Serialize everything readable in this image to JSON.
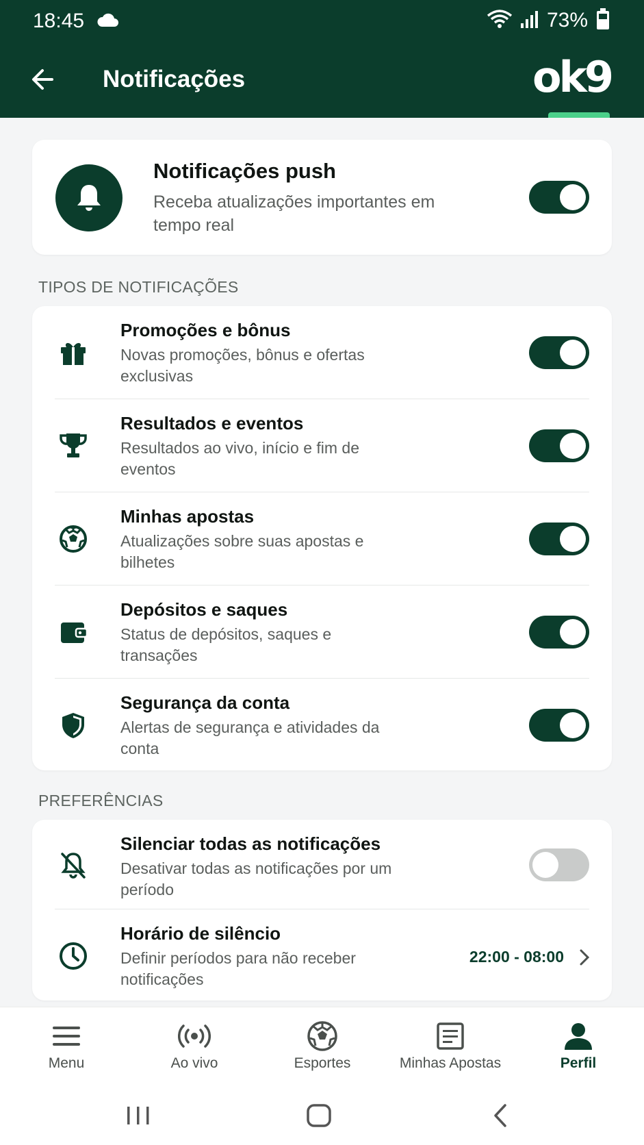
{
  "status_bar": {
    "time": "18:45",
    "battery": "73%",
    "icons": [
      "cloud-icon",
      "wifi-icon",
      "signal-icon",
      "battery-icon"
    ]
  },
  "app_bar": {
    "title": "Notificações",
    "logo": "ok9",
    "back_icon": "arrow-left-icon"
  },
  "push": {
    "title": "Notificações push",
    "description": "Receba atualizações importantes em tempo real",
    "enabled": true
  },
  "types_section": {
    "label": "TIPOS DE NOTIFICAÇÕES",
    "items": [
      {
        "title": "Promoções e bônus",
        "description": "Novas promoções, bônus e ofertas exclusivas",
        "icon": "gift-icon",
        "enabled": true
      },
      {
        "title": "Resultados e eventos",
        "description": "Resultados ao vivo, início e fim de eventos",
        "icon": "trophy-icon",
        "enabled": true
      },
      {
        "title": "Minhas apostas",
        "description": "Atualizações sobre suas apostas e bilhetes",
        "icon": "soccer-ball-icon",
        "enabled": true
      },
      {
        "title": "Depósitos e saques",
        "description": "Status de depósitos, saques e transações",
        "icon": "wallet-icon",
        "enabled": true
      },
      {
        "title": "Segurança da conta",
        "description": "Alertas de segurança e atividades da conta",
        "icon": "shield-icon",
        "enabled": true
      }
    ]
  },
  "preferences_section": {
    "label": "PREFERÊNCIAS",
    "mute": {
      "title": "Silenciar todas as notificações",
      "description": "Desativar todas as notificações por um período",
      "icon": "bell-off-icon",
      "enabled": false
    },
    "quiet_hours": {
      "title": "Horário de silêncio",
      "description": "Definir períodos para não receber notificações",
      "icon": "clock-icon",
      "value": "22:00 - 08:00"
    }
  },
  "bottom_nav": {
    "items": [
      {
        "label": "Menu",
        "icon": "menu-icon"
      },
      {
        "label": "Ao vivo",
        "icon": "live-broadcast-icon"
      },
      {
        "label": "Esportes",
        "icon": "soccer-ball-icon"
      },
      {
        "label": "Minhas Apostas",
        "icon": "ticket-icon"
      },
      {
        "label": "Perfil",
        "icon": "user-icon"
      }
    ],
    "active": "Perfil"
  },
  "colors": {
    "brand": "#0b3d2c",
    "accent": "#4bd08a",
    "background": "#f4f5f6"
  }
}
